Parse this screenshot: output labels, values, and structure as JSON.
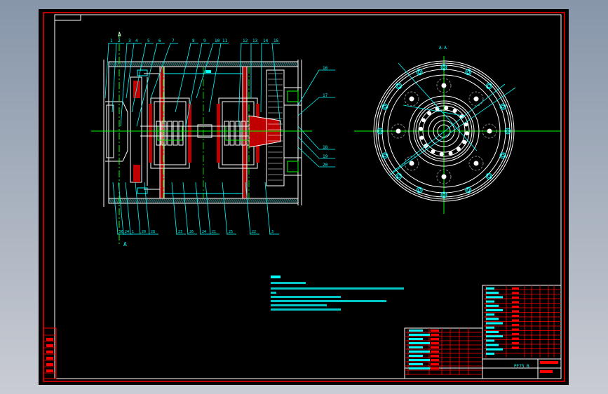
{
  "colors": {
    "background": "#000000",
    "border": "#ff0000",
    "frame": "#ffffff",
    "annotation": "#00ffff",
    "centerline": "#00ff00",
    "section_fill": "#ff2020",
    "hidden": "#808080"
  },
  "section_marker": {
    "top": "A",
    "bottom": "A"
  },
  "view_label": "A-A",
  "callouts_top": [
    "1",
    "2",
    "3",
    "4",
    "5",
    "6",
    "7",
    "8",
    "9",
    "10",
    "11",
    "12",
    "13",
    "14",
    "15"
  ],
  "callouts_right": [
    "16",
    "17",
    "18",
    "19",
    "20"
  ],
  "callouts_bottom": [
    "26",
    "24",
    "1",
    "20",
    "28",
    "23",
    "26",
    "24",
    "21",
    "25",
    "22",
    "3"
  ],
  "title_block": {
    "drawing_code": "PF75 B"
  }
}
